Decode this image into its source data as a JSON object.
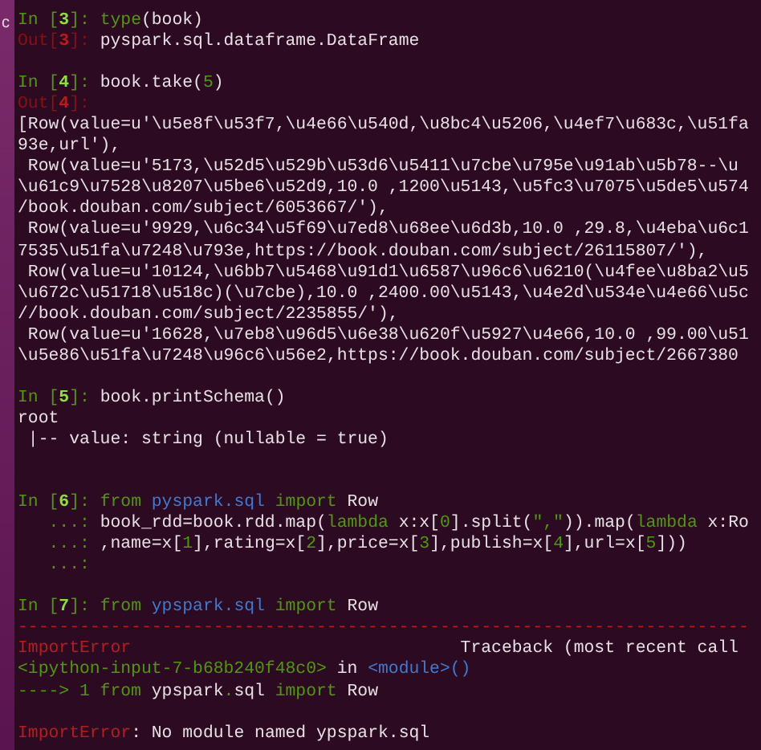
{
  "side_window": {
    "text": "c"
  },
  "lines": [
    {
      "kind": "code",
      "segments": [
        {
          "text": "In [",
          "kind": "prompt"
        },
        {
          "text": "3",
          "kind": "prompt-num"
        },
        {
          "text": "]: ",
          "kind": "prompt"
        },
        {
          "text": "type",
          "kind": "keyword"
        },
        {
          "text": "(book)",
          "kind": "text"
        }
      ]
    },
    {
      "kind": "code",
      "segments": [
        {
          "text": "Out[",
          "kind": "out"
        },
        {
          "text": "3",
          "kind": "out-num"
        },
        {
          "text": "]: ",
          "kind": "out"
        },
        {
          "text": "pyspark.sql.dataframe.DataFrame",
          "kind": "text"
        }
      ]
    },
    {
      "kind": "blank"
    },
    {
      "kind": "code",
      "segments": [
        {
          "text": "In [",
          "kind": "prompt"
        },
        {
          "text": "4",
          "kind": "prompt-num"
        },
        {
          "text": "]: ",
          "kind": "prompt"
        },
        {
          "text": "book.take(",
          "kind": "text"
        },
        {
          "text": "5",
          "kind": "number"
        },
        {
          "text": ")",
          "kind": "text"
        }
      ]
    },
    {
      "kind": "code",
      "segments": [
        {
          "text": "Out[",
          "kind": "out"
        },
        {
          "text": "4",
          "kind": "out-num"
        },
        {
          "text": "]:",
          "kind": "out"
        }
      ]
    },
    {
      "kind": "code",
      "segments": [
        {
          "text": "[Row(value=u'\\u5e8f\\u53f7,\\u4e66\\u540d,\\u8bc4\\u5206,\\u4ef7\\u683c,\\u51fa",
          "kind": "text"
        }
      ]
    },
    {
      "kind": "code",
      "segments": [
        {
          "text": "93e,url'),",
          "kind": "text"
        }
      ]
    },
    {
      "kind": "code",
      "segments": [
        {
          "text": " Row(value=u'5173,\\u52d5\\u529b\\u53d6\\u5411\\u7cbe\\u795e\\u91ab\\u5b78--\\u",
          "kind": "text"
        }
      ]
    },
    {
      "kind": "code",
      "segments": [
        {
          "text": "\\u61c9\\u7528\\u8207\\u5be6\\u52d9,10.0 ,1200\\u5143,\\u5fc3\\u7075\\u5de5\\u574",
          "kind": "text"
        }
      ]
    },
    {
      "kind": "code",
      "segments": [
        {
          "text": "/book.douban.com/subject/6053667/'),",
          "kind": "text"
        }
      ]
    },
    {
      "kind": "code",
      "segments": [
        {
          "text": " Row(value=u'9929,\\u6c34\\u5f69\\u7ed8\\u68ee\\u6d3b,10.0 ,29.8,\\u4eba\\u6c1",
          "kind": "text"
        }
      ]
    },
    {
      "kind": "code",
      "segments": [
        {
          "text": "7535\\u51fa\\u7248\\u793e,https://book.douban.com/subject/26115807/'),",
          "kind": "text"
        }
      ]
    },
    {
      "kind": "code",
      "segments": [
        {
          "text": " Row(value=u'10124,\\u6bb7\\u5468\\u91d1\\u6587\\u96c6\\u6210(\\u4fee\\u8ba2\\u5",
          "kind": "text"
        }
      ]
    },
    {
      "kind": "code",
      "segments": [
        {
          "text": "\\u672c\\u51718\\u518c)(\\u7cbe),10.0 ,2400.00\\u5143,\\u4e2d\\u534e\\u4e66\\u5c",
          "kind": "text"
        }
      ]
    },
    {
      "kind": "code",
      "segments": [
        {
          "text": "//book.douban.com/subject/2235855/'),",
          "kind": "text"
        }
      ]
    },
    {
      "kind": "code",
      "segments": [
        {
          "text": " Row(value=u'16628,\\u7eb8\\u96d5\\u6e38\\u620f\\u5927\\u4e66,10.0 ,99.00\\u51",
          "kind": "text"
        }
      ]
    },
    {
      "kind": "code",
      "segments": [
        {
          "text": "\\u5e86\\u51fa\\u7248\\u96c6\\u56e2,https://book.douban.com/subject/2667380",
          "kind": "text"
        }
      ]
    },
    {
      "kind": "blank"
    },
    {
      "kind": "code",
      "segments": [
        {
          "text": "In [",
          "kind": "prompt"
        },
        {
          "text": "5",
          "kind": "prompt-num"
        },
        {
          "text": "]: ",
          "kind": "prompt"
        },
        {
          "text": "book.printSchema()",
          "kind": "text"
        }
      ]
    },
    {
      "kind": "code",
      "segments": [
        {
          "text": "root",
          "kind": "text"
        }
      ]
    },
    {
      "kind": "code",
      "segments": [
        {
          "text": " |-- value: string (nullable = true)",
          "kind": "text"
        }
      ]
    },
    {
      "kind": "blank"
    },
    {
      "kind": "blank"
    },
    {
      "kind": "code",
      "segments": [
        {
          "text": "In [",
          "kind": "prompt"
        },
        {
          "text": "6",
          "kind": "prompt-num"
        },
        {
          "text": "]: ",
          "kind": "prompt"
        },
        {
          "text": "from",
          "kind": "keyword"
        },
        {
          "text": " pyspark.sql",
          "kind": "module"
        },
        {
          "text": " import",
          "kind": "keyword"
        },
        {
          "text": " Row",
          "kind": "text"
        }
      ]
    },
    {
      "kind": "code",
      "segments": [
        {
          "text": "   ...: ",
          "kind": "prompt"
        },
        {
          "text": "book_rdd=book.rdd.map(",
          "kind": "text"
        },
        {
          "text": "lambda",
          "kind": "keyword"
        },
        {
          "text": " x:x[",
          "kind": "text"
        },
        {
          "text": "0",
          "kind": "number"
        },
        {
          "text": "].split(",
          "kind": "text"
        },
        {
          "text": "\",\"",
          "kind": "string"
        },
        {
          "text": ")).map(",
          "kind": "text"
        },
        {
          "text": "lambda",
          "kind": "keyword"
        },
        {
          "text": " x:Ro",
          "kind": "text"
        }
      ]
    },
    {
      "kind": "code",
      "segments": [
        {
          "text": "   ...: ",
          "kind": "prompt"
        },
        {
          "text": ",name=x[",
          "kind": "text"
        },
        {
          "text": "1",
          "kind": "number"
        },
        {
          "text": "],rating=x[",
          "kind": "text"
        },
        {
          "text": "2",
          "kind": "number"
        },
        {
          "text": "],price=x[",
          "kind": "text"
        },
        {
          "text": "3",
          "kind": "number"
        },
        {
          "text": "],publish=x[",
          "kind": "text"
        },
        {
          "text": "4",
          "kind": "number"
        },
        {
          "text": "],url=x[",
          "kind": "text"
        },
        {
          "text": "5",
          "kind": "number"
        },
        {
          "text": "]))",
          "kind": "text"
        }
      ]
    },
    {
      "kind": "code",
      "segments": [
        {
          "text": "   ...:",
          "kind": "prompt"
        }
      ]
    },
    {
      "kind": "blank"
    },
    {
      "kind": "code",
      "segments": [
        {
          "text": "In [",
          "kind": "prompt"
        },
        {
          "text": "7",
          "kind": "prompt-num"
        },
        {
          "text": "]: ",
          "kind": "prompt"
        },
        {
          "text": "from",
          "kind": "keyword"
        },
        {
          "text": " ypspark.sql",
          "kind": "module"
        },
        {
          "text": " import",
          "kind": "keyword"
        },
        {
          "text": " Row",
          "kind": "text"
        }
      ]
    },
    {
      "kind": "code",
      "segments": [
        {
          "text": "-----------------------------------------------------------------------",
          "kind": "error"
        }
      ]
    },
    {
      "kind": "code",
      "segments": [
        {
          "text": "ImportError",
          "kind": "error"
        },
        {
          "text": "                                Traceback (most recent call",
          "kind": "text"
        }
      ]
    },
    {
      "kind": "code",
      "segments": [
        {
          "text": "<ipython-input-7-b68b240f48c0>",
          "kind": "keyword"
        },
        {
          "text": " in ",
          "kind": "text"
        },
        {
          "text": "<module>()",
          "kind": "module"
        }
      ]
    },
    {
      "kind": "code",
      "segments": [
        {
          "text": "----> 1 from",
          "kind": "keyword"
        },
        {
          "text": " ypspark",
          "kind": "text"
        },
        {
          "text": ".",
          "kind": "keyword"
        },
        {
          "text": "sql ",
          "kind": "text"
        },
        {
          "text": "import",
          "kind": "keyword"
        },
        {
          "text": " Row",
          "kind": "text"
        }
      ]
    },
    {
      "kind": "blank"
    },
    {
      "kind": "code",
      "segments": [
        {
          "text": "ImportError",
          "kind": "error"
        },
        {
          "text": ": No module named ypspark.sql",
          "kind": "text"
        }
      ]
    }
  ]
}
